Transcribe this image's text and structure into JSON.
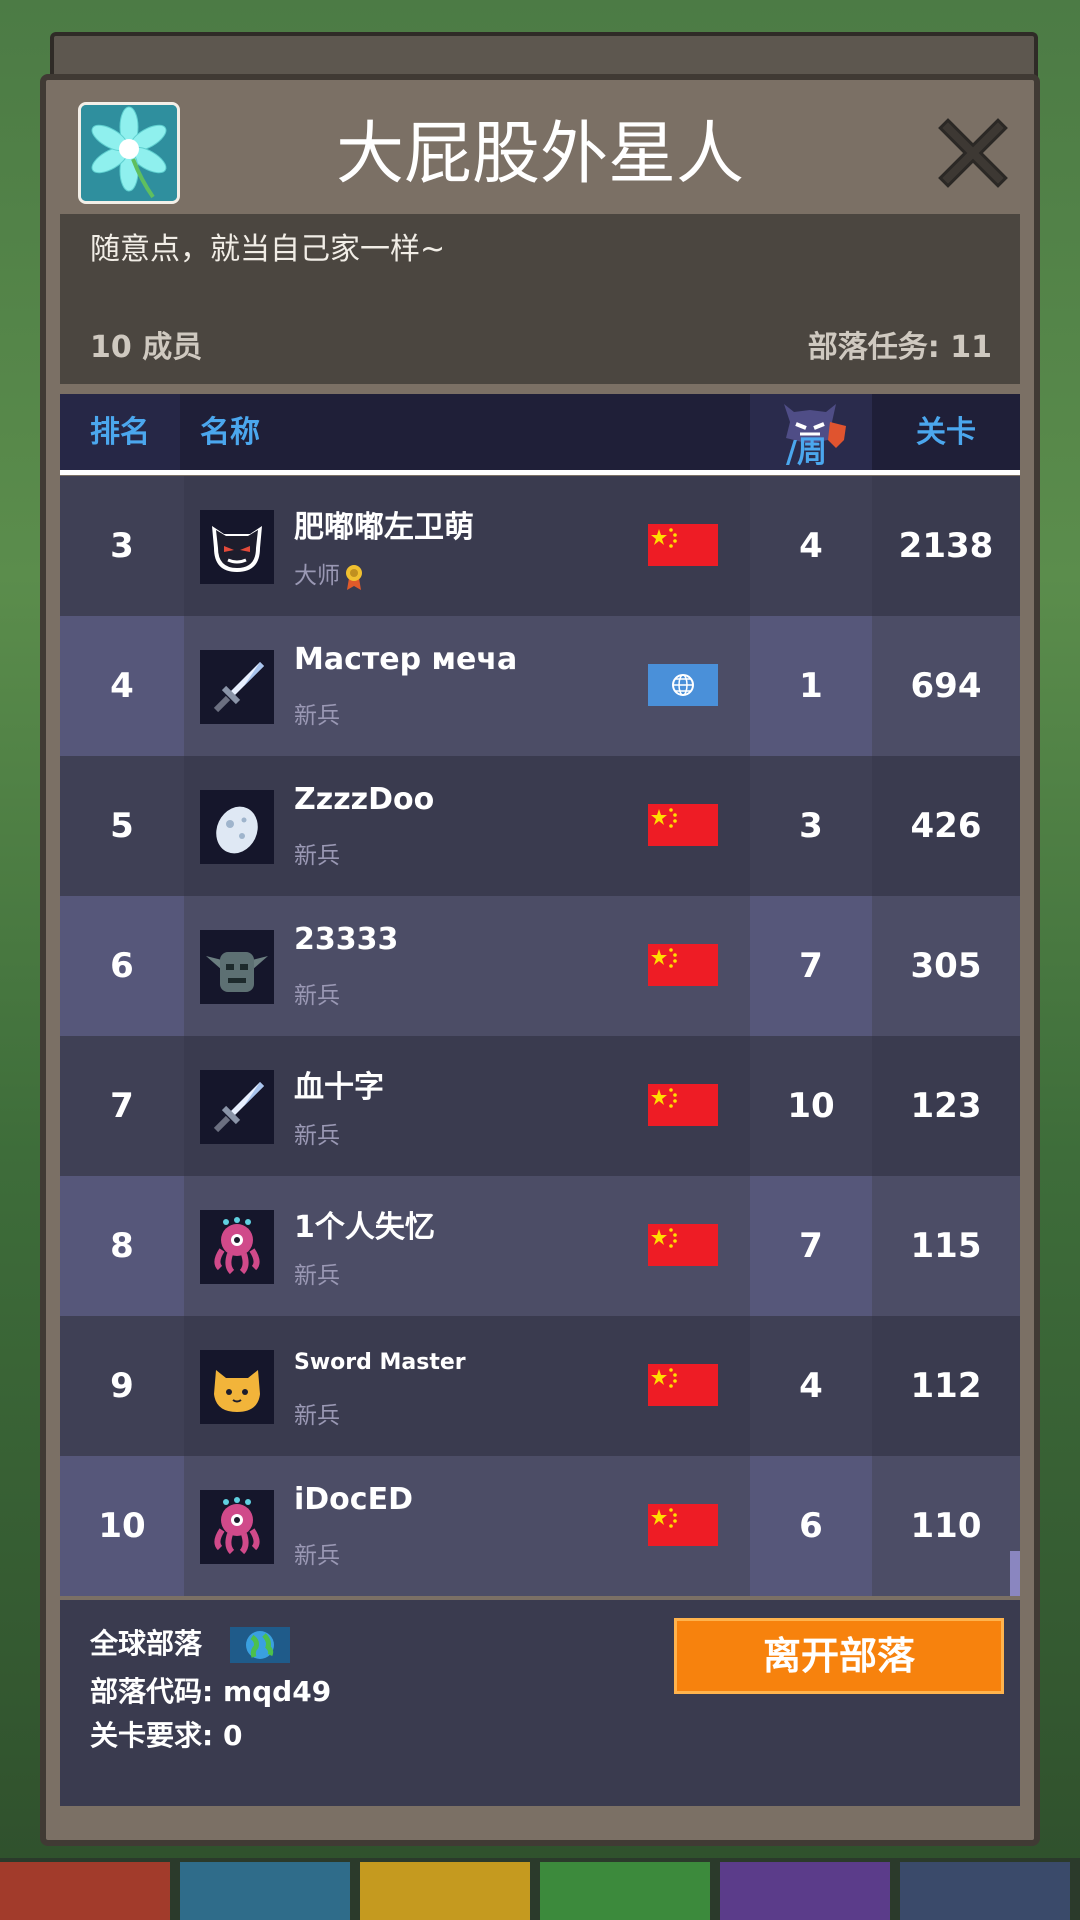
{
  "clan": {
    "name": "大屁股外星人",
    "description": "随意点，就当自己家一样~",
    "members_label": "10 成员",
    "quests_label": "部落任务: 11"
  },
  "table": {
    "headers": {
      "rank": "排名",
      "name": "名称",
      "week": "/周",
      "level": "关卡"
    },
    "rows": [
      {
        "rank": "3",
        "name": "肥嘟嘟左卫萌",
        "title": "大师",
        "flag": "cn",
        "avatar": "devil-icon",
        "week": "4",
        "level": "2138"
      },
      {
        "rank": "4",
        "name": "Мастер меча",
        "title": "新兵",
        "flag": "globe",
        "avatar": "sword-icon",
        "week": "1",
        "level": "694"
      },
      {
        "rank": "5",
        "name": "ZzzzDoo",
        "title": "新兵",
        "flag": "cn",
        "avatar": "egg-icon",
        "week": "3",
        "level": "426"
      },
      {
        "rank": "6",
        "name": "23333",
        "title": "新兵",
        "flag": "cn",
        "avatar": "goblin-icon",
        "week": "7",
        "level": "305"
      },
      {
        "rank": "7",
        "name": "血十字",
        "title": "新兵",
        "flag": "cn",
        "avatar": "sword-icon",
        "week": "10",
        "level": "123"
      },
      {
        "rank": "8",
        "name": "1个人失忆",
        "title": "新兵",
        "flag": "cn",
        "avatar": "octopus-icon",
        "week": "7",
        "level": "115"
      },
      {
        "rank": "9",
        "name": "Sword Master",
        "title": "新兵",
        "flag": "cn",
        "avatar": "cat-icon",
        "week": "4",
        "level": "112"
      },
      {
        "rank": "10",
        "name": "iDocED",
        "title": "新兵",
        "flag": "cn",
        "avatar": "octopus-icon",
        "week": "6",
        "level": "110"
      }
    ]
  },
  "footer": {
    "global_label": "全球部落",
    "code_label": "部落代码: mqd49",
    "requirement_label": "关卡要求:  0",
    "leave_button": "离开部落"
  },
  "colors": {
    "accent_blue": "#4ba7ee",
    "leave_orange": "#f7820d",
    "panel_brown": "#7b7065"
  }
}
